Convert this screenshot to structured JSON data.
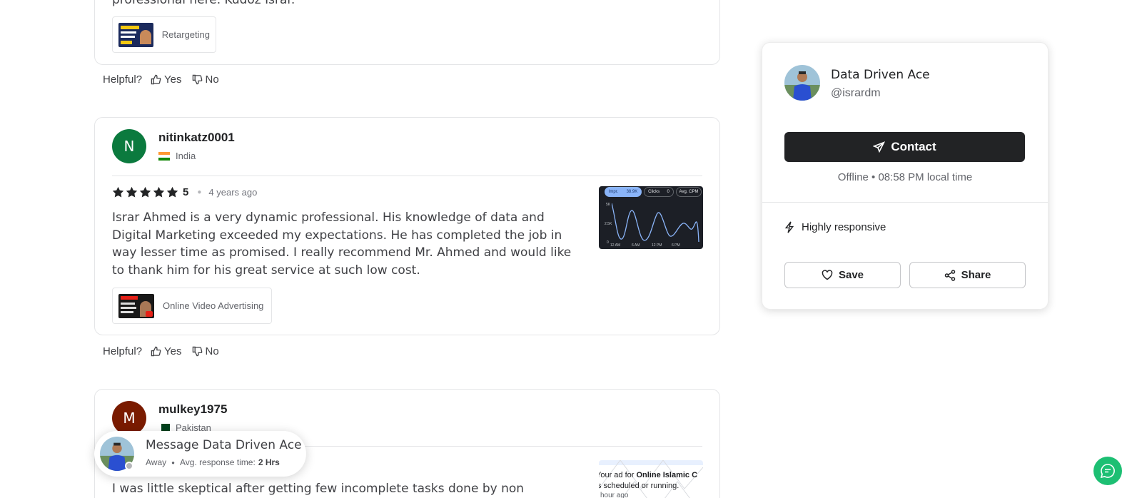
{
  "reviews": [
    {
      "partial_text": "professional here. Kudoz Israr.",
      "service": "Retargeting",
      "helpful_label": "Helpful?",
      "yes_label": "Yes",
      "no_label": "No"
    },
    {
      "initial": "N",
      "avatar_color": "#0b7a3e",
      "username": "nitinkatz0001",
      "country": "India",
      "rating": "5",
      "time_ago": "4 years ago",
      "text": "Israr Ahmed is a very dynamic professional. His knowledge of data and Digital Marketing exceeded my expectations. He has completed the job in way lesser time as promised. I really recommend Mr. Ahmed and would like to thank him for his great service at such low cost.",
      "service": "Online Video Advertising",
      "helpful_label": "Helpful?",
      "yes_label": "Yes",
      "no_label": "No",
      "image_chart": {
        "impr_label": "Impr.",
        "impr_value": "38.9K",
        "clicks_label": "Clicks",
        "clicks_value": "0",
        "cpm_label": "Avg. CPM",
        "y_ticks": [
          "5K",
          "2.5K",
          "0"
        ],
        "x_ticks": [
          "12 AM",
          "6 AM",
          "12 PM",
          "6 PM"
        ]
      }
    },
    {
      "initial": "M",
      "avatar_color": "#7a1b00",
      "username": "mulkey1975",
      "country": "Pakistan",
      "text": "I was little skeptical after getting few incomplete tasks done by non committed",
      "image_text": {
        "line1_prefix": "Your ad for ",
        "line1_bold": "Online Islamic C",
        "line2": "s scheduled or running.",
        "line3": "hour ago"
      }
    }
  ],
  "seller": {
    "name": "Data Driven Ace",
    "handle": "@isrardm",
    "contact_label": "Contact",
    "status": "Offline • 08:58 PM local time",
    "responsive_label": "Highly responsive",
    "save_label": "Save",
    "share_label": "Share"
  },
  "message_popup": {
    "title": "Message Data Driven Ace",
    "status": "Away",
    "response_label": "Avg. response time:",
    "response_value": "2 Hrs"
  },
  "colors": {
    "accent_green": "#1dbf73",
    "dark_button": "#222325"
  }
}
